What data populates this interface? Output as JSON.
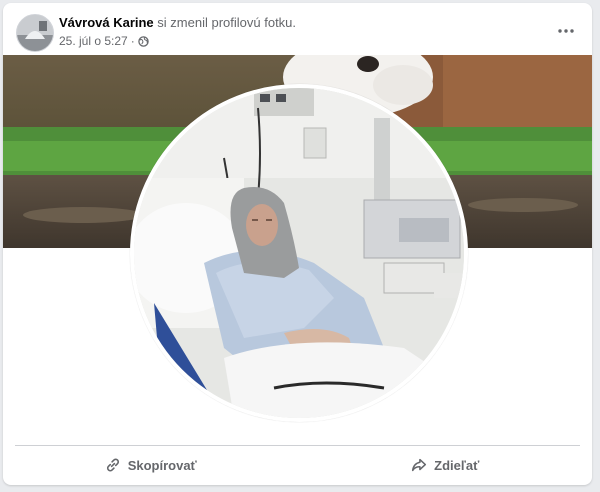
{
  "post": {
    "author": "Vávrová Karine",
    "action_text": "si zmenil profilovú fotku.",
    "timestamp": "25. júl o 5:27",
    "separator": "·",
    "privacy_icon": "globe-icon",
    "more_icon": "more-horizontal-icon"
  },
  "images": {
    "cover": "cover-photo",
    "profile": "profile-photo"
  },
  "actions": {
    "copy": {
      "label": "Skopírovať",
      "icon": "link-icon"
    },
    "share": {
      "label": "Zdieľať",
      "icon": "share-arrow-icon"
    }
  },
  "colors": {
    "text_primary": "#050505",
    "text_secondary": "#65676b",
    "divider": "#ced0d4",
    "page_bg": "#e9ebee"
  }
}
